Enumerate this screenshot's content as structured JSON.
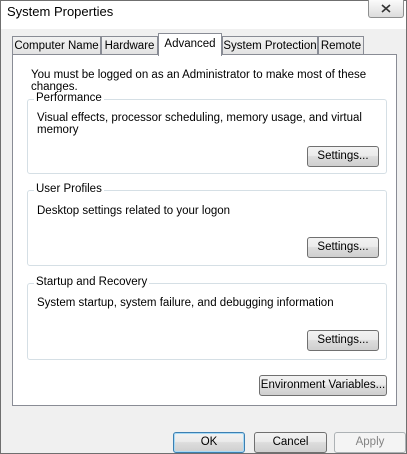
{
  "window": {
    "title": "System Properties",
    "close_icon": "close-icon"
  },
  "tabs": [
    {
      "label": "Computer Name",
      "active": false
    },
    {
      "label": "Hardware",
      "active": false
    },
    {
      "label": "Advanced",
      "active": true
    },
    {
      "label": "System Protection",
      "active": false
    },
    {
      "label": "Remote",
      "active": false
    }
  ],
  "advanced": {
    "admin_note": "You must be logged on as an Administrator to make most of these changes.",
    "performance": {
      "legend": "Performance",
      "description": "Visual effects, processor scheduling, memory usage, and virtual memory",
      "button": "Settings..."
    },
    "user_profiles": {
      "legend": "User Profiles",
      "description": "Desktop settings related to your logon",
      "button": "Settings..."
    },
    "startup_recovery": {
      "legend": "Startup and Recovery",
      "description": "System startup, system failure, and debugging information",
      "button": "Settings..."
    },
    "env_vars_button": "Environment Variables..."
  },
  "footer": {
    "ok": "OK",
    "cancel": "Cancel",
    "apply": "Apply"
  },
  "colors": {
    "tab_border": "#898c95",
    "group_border": "#d5dfe5",
    "default_button_border": "#3c7fb1"
  }
}
